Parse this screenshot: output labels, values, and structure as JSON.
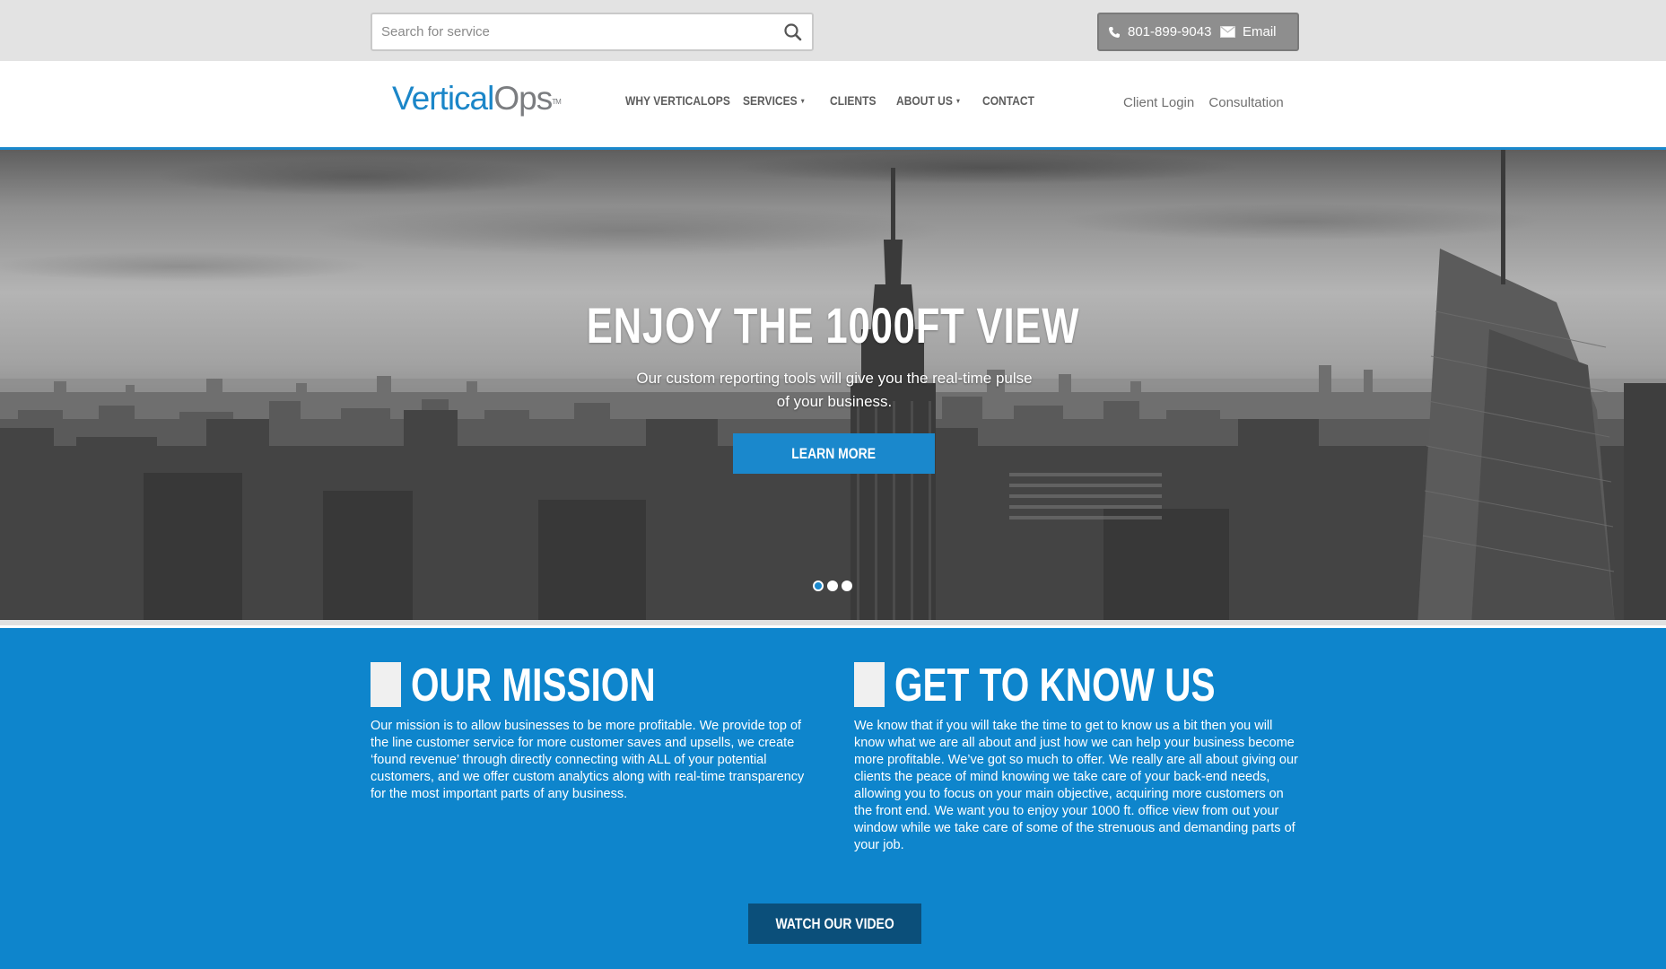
{
  "search": {
    "placeholder": "Search for service",
    "icon": "search-icon"
  },
  "contact": {
    "phone": "801-899-9043",
    "email": "Email",
    "phone_icon": "phone-icon",
    "email_icon": "envelope-icon"
  },
  "logo": {
    "part1": "Vertical",
    "part2": "Ops",
    "tm": "TM"
  },
  "nav": {
    "items": [
      {
        "label": "WHY VERTICALOPS",
        "has_caret": false
      },
      {
        "label": "SERVICES",
        "has_caret": true
      },
      {
        "label": "CLIENTS",
        "has_caret": false
      },
      {
        "label": "ABOUT US",
        "has_caret": true
      },
      {
        "label": "CONTACT",
        "has_caret": false
      }
    ],
    "caret": "▾"
  },
  "header_links": {
    "client_login": "Client Login",
    "consultation": "Consultation"
  },
  "hero": {
    "title": "ENJOY THE 1000FT VIEW",
    "subtitle": "Our custom reporting tools will give you the real-time pulse of your business.",
    "cta": "LEARN MORE",
    "slides": 3,
    "active_slide": 1
  },
  "mission": {
    "heading": "OUR MISSION",
    "body": "Our mission is to allow businesses to be more profitable. We provide top of the line customer service for more customer saves and upsells, we create ‘found revenue’ through directly connecting with ALL of your potential customers, and we offer custom analytics along with real-time transparency for the most important parts of any business."
  },
  "know_us": {
    "heading": "GET TO KNOW US",
    "body": "We know that if you will take the time to get to know us a bit then you will know what we are all about and just how we can help your business become more profitable. We’ve got so much to offer. We really are all about giving our clients the peace of mind knowing we take care of your back-end needs, allowing you to focus on your main objective, acquiring more customers on the front end. We want you to enjoy your 1000 ft. office view from out your window while we take care of some of the strenuous and demanding parts of your job."
  },
  "video": {
    "cta": "WATCH OUR VIDEO"
  },
  "colors": {
    "accent_blue": "#1a88cc",
    "section_blue": "#0e85cc",
    "dark_button": "#0b4f7a",
    "utility_gray": "#e3e3e3"
  }
}
